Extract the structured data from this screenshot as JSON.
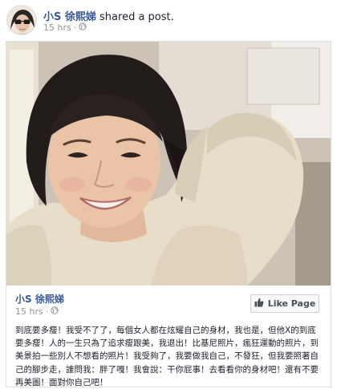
{
  "header": {
    "author": "小S 徐熙娣",
    "action": "shared a post.",
    "time": "15 hrs",
    "separator": "·",
    "privacy_icon": "globe-icon"
  },
  "shared_post": {
    "author": "小S 徐熙娣",
    "time": "15 hrs",
    "separator": "·",
    "privacy_icon": "globe-icon",
    "like_page_label": "Like Page",
    "like_icon": "thumbs-up-icon",
    "text": "到底要多瘦！我受不了了，每個女人都在炫耀自己的身材，我也是，但他X的到底要多瘦！人的一生只為了追求瘦跟美，我退出！比基尼照片，瘋狂運動的照片，到美景拍一些別人不想看的照片！我受夠了，我要做我自己，不發狂，但我要照著自己的腳步走，誰問我：胖了嘎！我會說：干你屁事！去看看你的身材吧！還有不要再美圖！面對你自己吧！"
  },
  "colors": {
    "link": "#385898",
    "meta": "#90949c",
    "border": "#dddfe2"
  }
}
